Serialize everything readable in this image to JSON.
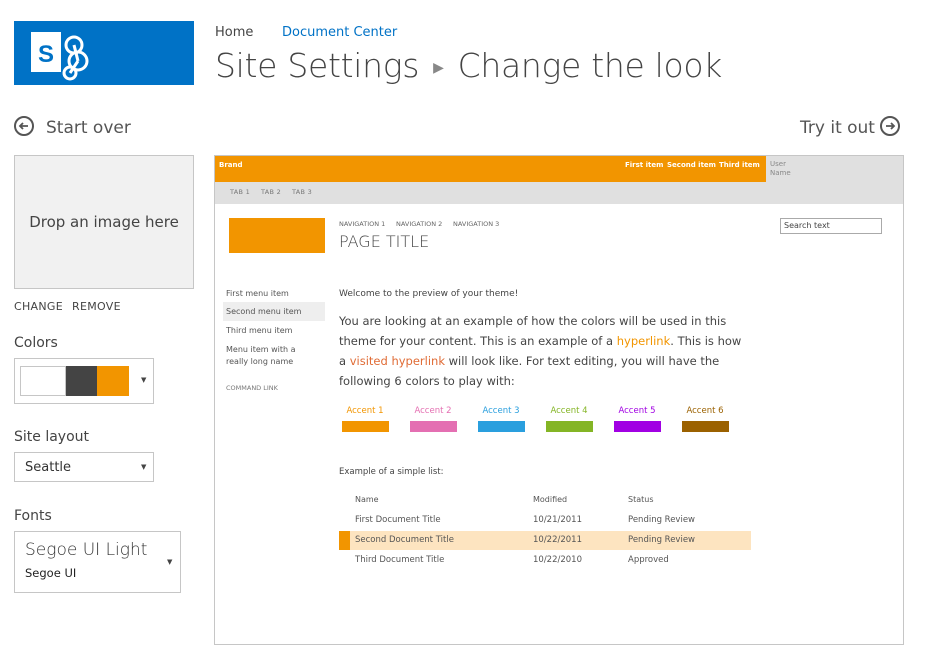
{
  "breadcrumb": {
    "home": "Home",
    "current": "Document Center"
  },
  "page_title": {
    "part1": "Site Settings",
    "part2": "Change the look"
  },
  "nav": {
    "start_over": "Start over",
    "try_it_out": "Try it out"
  },
  "image": {
    "drop_text": "Drop an image here",
    "change": "CHANGE",
    "remove": "REMOVE"
  },
  "colors": {
    "label": "Colors",
    "swatches": [
      "#ffffff",
      "#444444",
      "#f29500"
    ]
  },
  "layout": {
    "label": "Site layout",
    "value": "Seattle"
  },
  "fonts": {
    "label": "Fonts",
    "heading": "Segoe UI Light",
    "body": "Segoe UI"
  },
  "preview": {
    "brand": "Brand",
    "top_links": [
      "First item",
      "Second item",
      "Third item"
    ],
    "user_name": "User Name",
    "tabs": [
      "TAB 1",
      "TAB 2",
      "TAB 3"
    ],
    "navigation": [
      "NAVIGATION 1",
      "NAVIGATION 2",
      "NAVIGATION 3"
    ],
    "page_title": "PAGE TITLE",
    "search_placeholder": "Search text",
    "menu": [
      "First menu item",
      "Second menu item",
      "Third menu item",
      "Menu item with a really long name"
    ],
    "command_link": "COMMAND LINK",
    "welcome": "Welcome to the preview of your theme!",
    "para1": "You are looking at an example of how the colors will be used in this theme for your content. This is an example of a",
    "hyperlink": "hyperlink",
    "para2": ". This is how a",
    "visited": "visited hyperlink",
    "para3": "will look like. For text editing, you will have the following 6 colors to play with:",
    "accents": [
      {
        "label": "Accent 1",
        "color": "#f29500"
      },
      {
        "label": "Accent 2",
        "color": "#e46fb2"
      },
      {
        "label": "Accent 3",
        "color": "#2a9fde"
      },
      {
        "label": "Accent 4",
        "color": "#84b525"
      },
      {
        "label": "Accent 5",
        "color": "#a100e3"
      },
      {
        "label": "Accent 6",
        "color": "#9b6100"
      }
    ],
    "list_title": "Example of a simple list:",
    "columns": [
      "Name",
      "Modified",
      "Status"
    ],
    "rows": [
      [
        "First Document Title",
        "10/21/2011",
        "Pending Review"
      ],
      [
        "Second Document Title",
        "10/22/2011",
        "Pending Review"
      ],
      [
        "Third Document Title",
        "10/22/2010",
        "Approved"
      ]
    ]
  }
}
